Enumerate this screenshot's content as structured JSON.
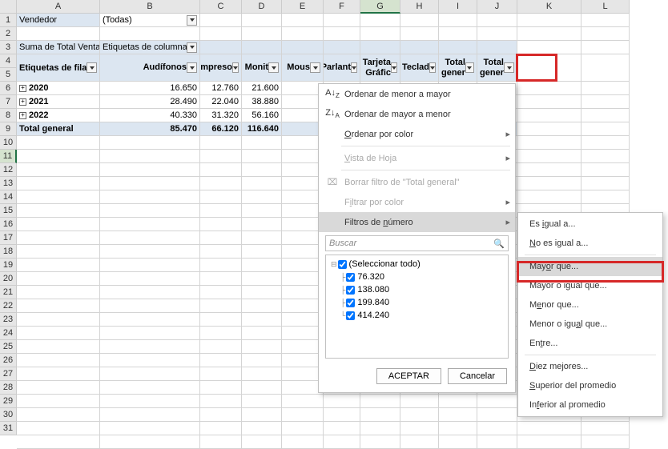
{
  "columns": [
    {
      "letter": "A",
      "w": 104
    },
    {
      "letter": "B",
      "w": 125
    },
    {
      "letter": "C",
      "w": 52
    },
    {
      "letter": "D",
      "w": 50
    },
    {
      "letter": "E",
      "w": 52
    },
    {
      "letter": "F",
      "w": 46
    },
    {
      "letter": "G",
      "w": 50
    },
    {
      "letter": "H",
      "w": 48
    },
    {
      "letter": "I",
      "w": 48
    },
    {
      "letter": "J",
      "w": 50
    },
    {
      "letter": "K",
      "w": 80
    },
    {
      "letter": "L",
      "w": 60
    }
  ],
  "row_numbers": [
    1,
    2,
    3,
    4,
    5,
    6,
    7,
    8,
    9,
    10,
    11,
    12,
    13,
    14,
    15,
    16,
    17,
    18,
    19,
    20,
    21,
    22,
    23,
    24,
    25,
    26,
    27,
    28,
    29,
    30,
    31
  ],
  "selected_col": "G",
  "selected_row": 11,
  "filter_row": {
    "label": "Vendedor",
    "value": "(Todas)"
  },
  "pivot_header": {
    "measure": "Suma de Total Ventas",
    "col_label": "Etiquetas de columna"
  },
  "col_labels": [
    "Etiquetas de fila",
    "Audífonos",
    "Impresora",
    "Monitor",
    "Mouse",
    "Parlantes",
    "Tarjeta Gráfica",
    "Teclado",
    "Total general"
  ],
  "col_labels_short": [
    "Etiquetas de fila",
    "Audífonos",
    "Impreso",
    "Monit",
    "Mous",
    "Parlant",
    "Tarjeta Gráfic",
    "Teclad",
    "Total gener"
  ],
  "data_rows": [
    {
      "year": "2020",
      "v": [
        "16.650",
        "12.760",
        "21.600"
      ]
    },
    {
      "year": "2021",
      "v": [
        "28.490",
        "22.040",
        "38.880"
      ]
    },
    {
      "year": "2022",
      "v": [
        "40.330",
        "31.320",
        "56.160"
      ]
    }
  ],
  "total_row": {
    "label": "Total general",
    "v": [
      "85.470",
      "66.120",
      "116.640"
    ]
  },
  "filter_menu": {
    "sort_asc": "Ordenar de menor a mayor",
    "sort_desc": "Ordenar de mayor a menor",
    "sort_color": "Ordenar por color",
    "sheet_view": "Vista de Hoja",
    "clear_filter": "Borrar filtro de \"Total general\"",
    "filter_color": "Filtrar por color",
    "number_filter": "Filtros de número",
    "search_placeholder": "Buscar",
    "select_all": "(Seleccionar todo)",
    "values": [
      "76.320",
      "138.080",
      "199.840",
      "414.240"
    ],
    "accept": "ACEPTAR",
    "cancel": "Cancelar"
  },
  "submenu": {
    "equal": "Es igual a...",
    "not_equal": "No es igual a...",
    "greater": "Mayor que...",
    "gte": "Mayor o igual que...",
    "less": "Menor que...",
    "lte": "Menor o igual que...",
    "between": "Entre...",
    "top10": "Diez mejores...",
    "above_avg": "Superior del promedio",
    "below_avg": "Inferior al promedio"
  }
}
